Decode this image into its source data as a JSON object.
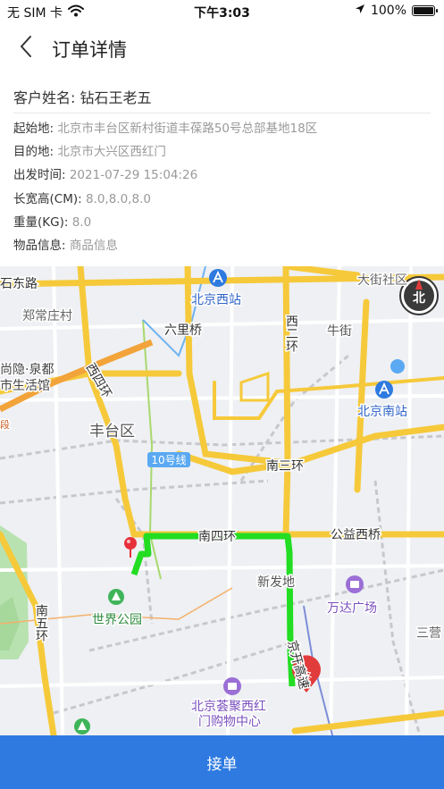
{
  "status": {
    "carrier": "无 SIM 卡",
    "time": "下午3:03",
    "battery": "100%"
  },
  "nav": {
    "title": "订单详情"
  },
  "customer": {
    "label": "客户姓名: ",
    "name": "钻石王老五"
  },
  "details": [
    {
      "label": "起始地: ",
      "value": "北京市丰台区新村街道丰葆路50号总部基地18区"
    },
    {
      "label": "目的地: ",
      "value": "北京市大兴区西红门"
    },
    {
      "label": "出发时间: ",
      "value": "2021-07-29 15:04:26"
    },
    {
      "label": "长宽高(CM): ",
      "value": "8.0,8.0,8.0"
    },
    {
      "label": "重量(KG): ",
      "value": "8.0"
    },
    {
      "label": "物品信息: ",
      "value": "商品信息"
    }
  ],
  "map": {
    "labels": {
      "shidong_road": "石东路",
      "dajie_community": "大街社区",
      "beijing_west": "北京西站",
      "zhengchang": "郑常庄村",
      "liulibridge": "六里桥",
      "xierhuan": "西二环",
      "niujie": "牛街",
      "shangyin1": "尚隐·泉都",
      "shangyin2": "市生活馆",
      "xisihuan": "西四环",
      "beijing_south": "北京南站",
      "duan": "段",
      "fengtai": "丰台区",
      "line10": "10号线",
      "nansanhuan": "南三环",
      "nansihuan": "南四环",
      "gongyi": "公益西桥",
      "xinfadi": "新发地",
      "wanda": "万达广场",
      "shijie_park": "世界公园",
      "nanwuhuan": "南五环",
      "sanying": "三营",
      "jingkai": "京开高速",
      "huiju1": "北京荟聚西红",
      "huiju2": "门购物中心",
      "end": "终",
      "compass": "北"
    }
  },
  "accept_label": "接单",
  "colors": {
    "accent": "#2e7ae0",
    "route": "#22dd22",
    "end_marker": "#e23b3b",
    "start_marker": "#e8303a"
  }
}
